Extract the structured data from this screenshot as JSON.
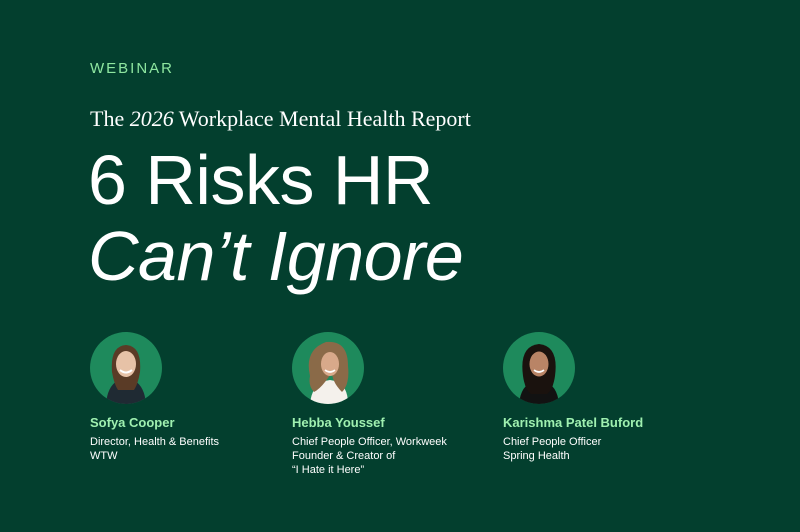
{
  "eyebrow": "WEBINAR",
  "subtitle": {
    "prefix": "The ",
    "year": "2026",
    "suffix": " Workplace Mental Health Report"
  },
  "headline": {
    "line1": "6 Risks HR",
    "line2": "Can’t Ignore"
  },
  "speakers": [
    {
      "name": "Sofya Cooper",
      "lines": [
        "Director, Health & Benefits",
        "WTW"
      ]
    },
    {
      "name": "Hebba Youssef",
      "lines": [
        "Chief People Officer, Workweek",
        "Founder & Creator of",
        "“I Hate it Here”"
      ]
    },
    {
      "name": "Karishma Patel Buford",
      "lines": [
        "Chief People Officer",
        "Spring Health"
      ]
    }
  ],
  "colors": {
    "background": "#033f2e",
    "accent": "#8ee6a0",
    "avatar_bg": "#1e8a5c"
  }
}
